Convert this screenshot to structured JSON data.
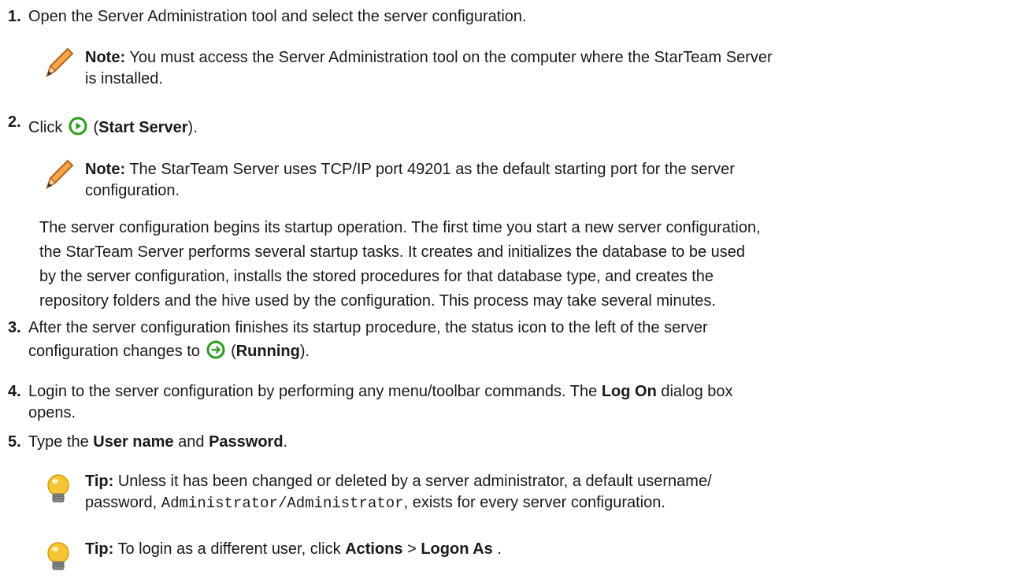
{
  "steps": [
    {
      "num": "1.",
      "text": "Open the Server Administration tool and select the server configuration."
    },
    {
      "num": "2.",
      "pre": "Click",
      "open": "(",
      "bold": "Start Server",
      "post": ")."
    },
    {
      "num": "3.",
      "line1": "After the server configuration finishes its startup procedure, the status icon to the left of the server",
      "pre": "configuration changes to",
      "open": "(",
      "bold": "Running",
      "post": ")."
    },
    {
      "num": "4.",
      "pre": "Login to the server configuration by performing any menu/toolbar commands. The",
      "bold": "Log On",
      "post": "dialog box",
      "line2": "opens."
    },
    {
      "num": "5.",
      "pre": "Type the",
      "bold1": "User name",
      "mid": "and",
      "bold2": "Password",
      "post": "."
    }
  ],
  "notes": [
    {
      "label": "Note:",
      "line1": "You must access the Server Administration tool on the computer where the StarTeam Server",
      "line2": "is installed."
    },
    {
      "label": "Note:",
      "line1": "The StarTeam Server uses TCP/IP port 49201 as the default starting port for the server",
      "line2": "configuration."
    }
  ],
  "paragraph": {
    "lines": [
      "The server configuration begins its startup operation. The first time you start a new server configuration,",
      "the StarTeam Server performs several startup tasks. It creates and initializes the database to be used",
      "by the server configuration, installs the stored procedures for that database type, and creates the",
      "repository folders and the hive used by the configuration. This process may take several minutes."
    ]
  },
  "tips": [
    {
      "label": "Tip:",
      "line1": "Unless it has been changed or deleted by a server administrator, a default username/",
      "line2_pre": "password,",
      "code": "Administrator/Administrator",
      "line2_post": ", exists for every server configuration."
    },
    {
      "label": "Tip:",
      "pre": "To login as a different user, click",
      "bold1": "Actions",
      "sep": ">",
      "bold2": "Logon As",
      "post": "."
    }
  ],
  "icons": {
    "start_server": "start-server-icon",
    "running": "running-icon",
    "note": "pencil-icon",
    "tip": "lightbulb-icon"
  },
  "colors": {
    "icon_green": "#2a9d1e",
    "bulb_yellow": "#f6c533",
    "pencil_orange": "#e8831f"
  }
}
